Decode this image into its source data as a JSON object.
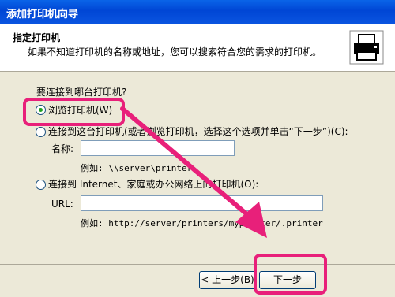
{
  "window": {
    "title": "添加打印机向导"
  },
  "header": {
    "title": "指定打印机",
    "subtitle": "如果不知道打印机的名称或地址，您可以搜索符合您的需求的打印机。",
    "icon": "printer-icon"
  },
  "question": "要连接到哪台打印机?",
  "options": [
    {
      "label": "浏览打印机(W)",
      "selected": true
    },
    {
      "label": "连接到这台打印机(或者浏览打印机，选择这个选项并单击“下一步”)(C):",
      "selected": false
    },
    {
      "label": "连接到 Internet、家庭或办公网络上的打印机(O):",
      "selected": false
    }
  ],
  "name_field": {
    "label": "名称:",
    "value": "",
    "example": "例如: \\\\server\\printer"
  },
  "url_field": {
    "label": "URL:",
    "value": "",
    "example": "例如: http://server/printers/myprinter/.printer"
  },
  "buttons": {
    "back": "< 上一步(B)",
    "next": "下一步"
  },
  "colors": {
    "titlebar": "#0a54e0",
    "highlight": "#e8207a"
  }
}
